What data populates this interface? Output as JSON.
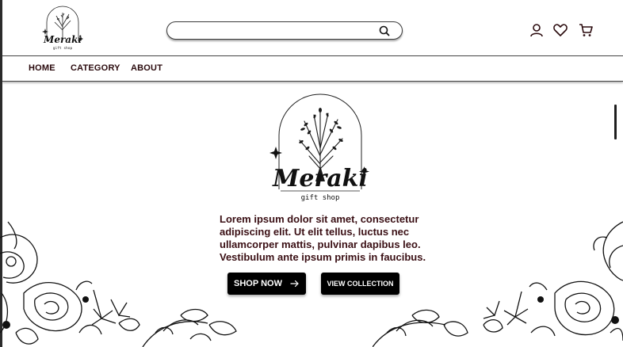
{
  "brand": {
    "name": "Meraki",
    "tagline": "gift shop"
  },
  "search": {
    "placeholder": "",
    "icon": "search-icon"
  },
  "header_icons": [
    "user-icon",
    "heart-icon",
    "cart-icon"
  ],
  "nav": {
    "items": [
      {
        "label": "HOME"
      },
      {
        "label": "CATEGORY"
      },
      {
        "label": "ABOUT"
      }
    ]
  },
  "hero": {
    "text": "Lorem ipsum dolor sit amet, consectetur adipiscing elit. Ut elit tellus, luctus nec ullamcorper mattis, pulvinar dapibus leo. Vestibulum ante ipsum primis in faucibus.",
    "shop_button": "SHOP NOW",
    "view_button": "VIEW COLLECTION"
  },
  "colors": {
    "text": "#2a0a0d",
    "button_bg": "#000000",
    "button_text": "#ffffff",
    "background": "#ffffff"
  }
}
